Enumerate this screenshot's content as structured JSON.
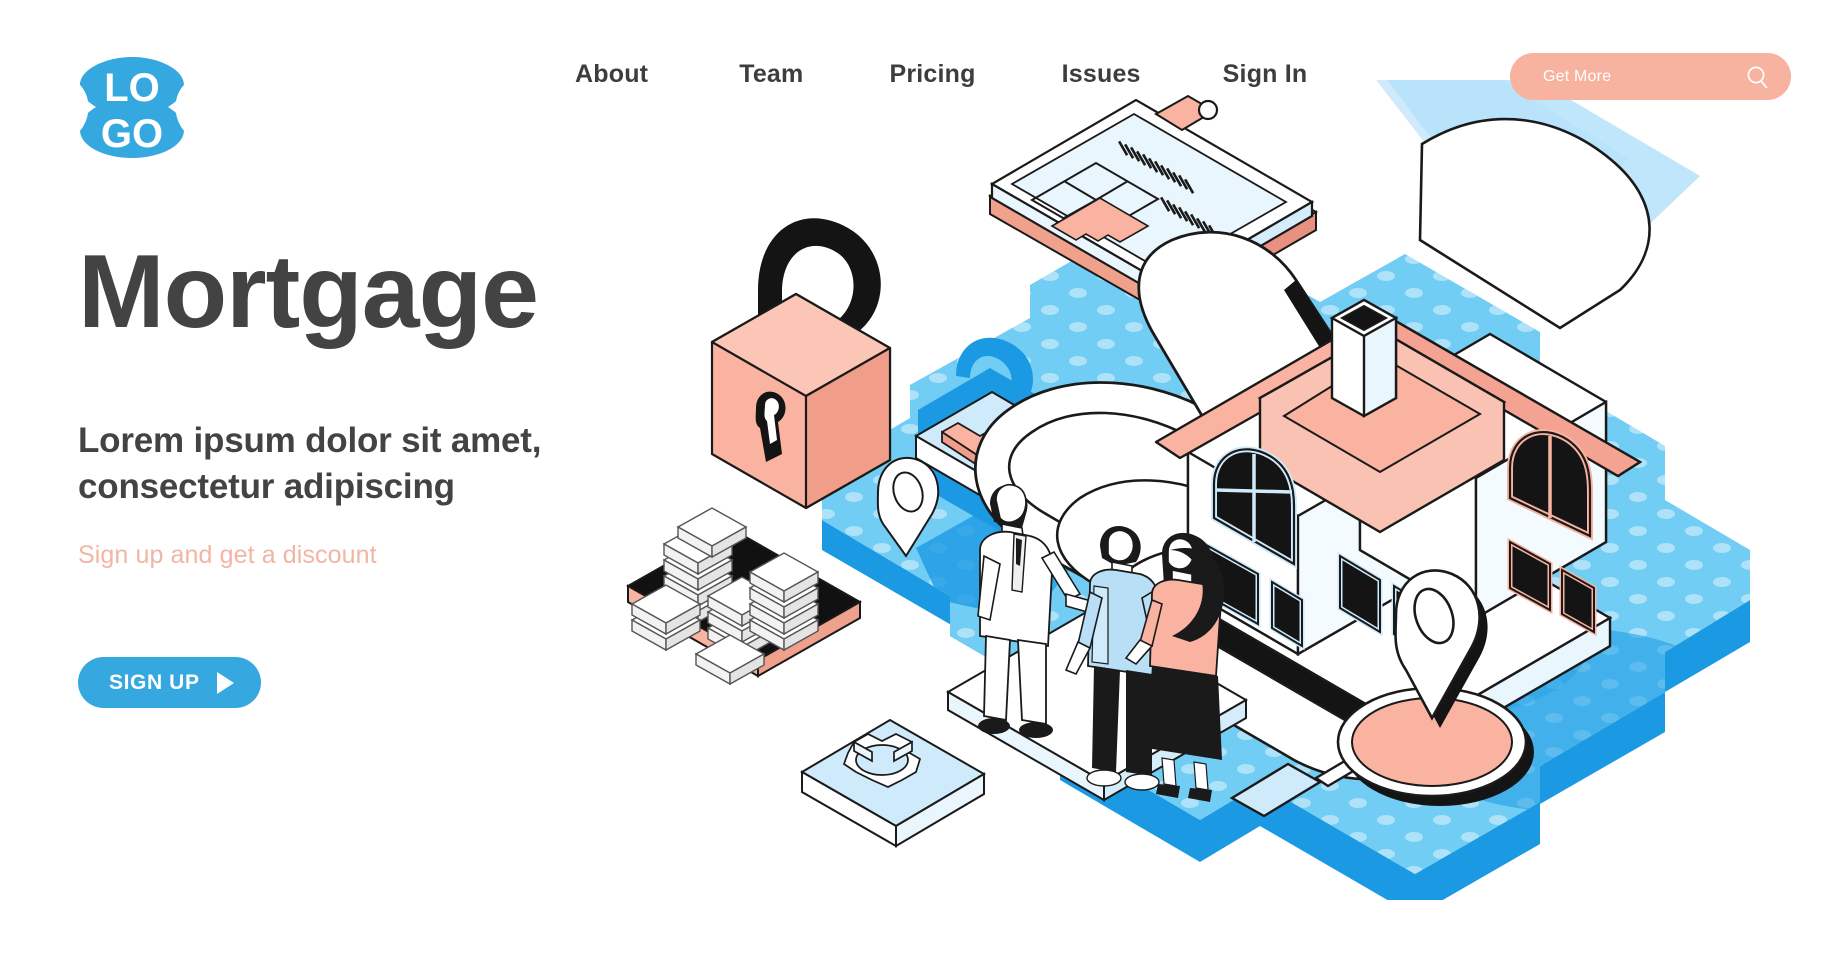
{
  "header": {
    "logo": {
      "name": "LOGO",
      "line1": "LO",
      "line2": "GO",
      "color": "#35a8e0"
    },
    "nav": [
      {
        "label": "About"
      },
      {
        "label": "Team"
      },
      {
        "label": "Pricing"
      },
      {
        "label": "Issues"
      },
      {
        "label": "Sign In"
      }
    ],
    "search": {
      "placeholder": "Get More",
      "value": "",
      "icon": "search-icon",
      "background": "#f7b2a0"
    }
  },
  "hero": {
    "title": "Mortgage",
    "subtitle": "Lorem ipsum dolor sit amet, consectetur adipiscing",
    "note": "Sign up and get a discount",
    "cta": {
      "label": "SIGN UP",
      "icon": "play-triangle-icon",
      "background": "#35a8e0"
    }
  },
  "illustration": {
    "alt": "Isometric mortgage scene",
    "elements": [
      "platform",
      "padlock",
      "clipboard-floorplan",
      "checkmark-tile",
      "coin-stacks",
      "gear-tile",
      "location-pin",
      "handshake-group",
      "house",
      "giant-hand",
      "key",
      "magnifier-with-pin"
    ],
    "colors": {
      "platform": "#72cdf4",
      "platform_side": "#1b9ae3",
      "accent_salmon": "#f9b3a0",
      "accent_blue": "#35a8e0",
      "light_blue": "#cfeafb",
      "dark": "#1a1a1a",
      "white": "#ffffff"
    }
  }
}
